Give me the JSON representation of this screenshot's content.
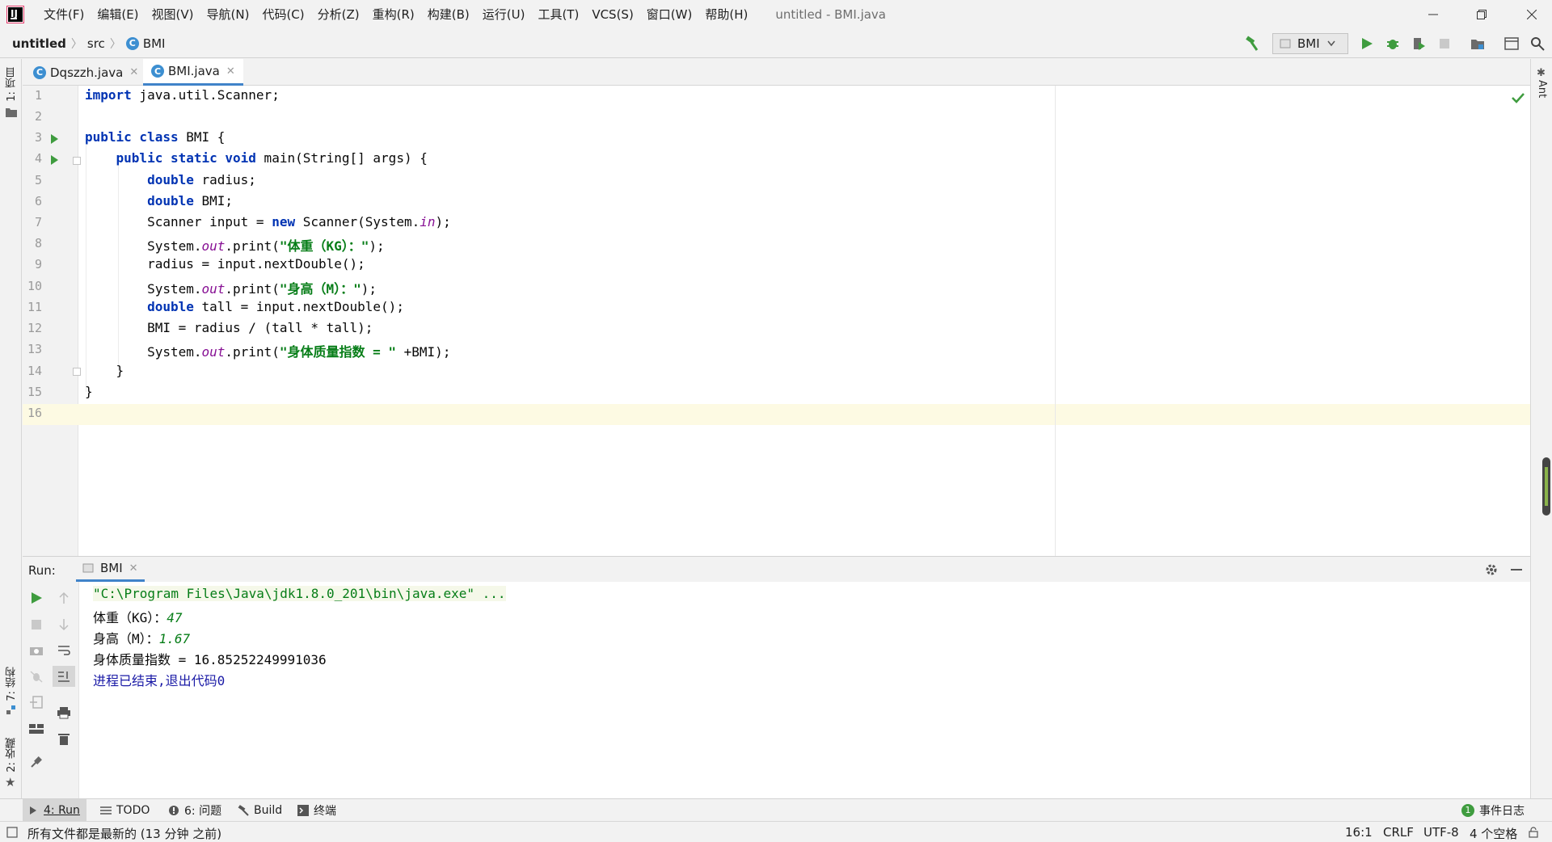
{
  "menu": {
    "items": [
      "文件(F)",
      "编辑(E)",
      "视图(V)",
      "导航(N)",
      "代码(C)",
      "分析(Z)",
      "重构(R)",
      "构建(B)",
      "运行(U)",
      "工具(T)",
      "VCS(S)",
      "窗口(W)",
      "帮助(H)"
    ],
    "window_title": "untitled - BMI.java"
  },
  "breadcrumb": {
    "project": "untitled",
    "folder": "src",
    "file": "BMI"
  },
  "toolbar": {
    "run_config": "BMI"
  },
  "side_tabs": {
    "project": "1: 项目",
    "structure": "7: 结构",
    "favorites": "2: 收藏",
    "ant": "Ant"
  },
  "editor_tabs": [
    {
      "label": "Dqszzh.java",
      "active": false
    },
    {
      "label": "BMI.java",
      "active": true
    }
  ],
  "editor": {
    "line_numbers": [
      "1",
      "2",
      "3",
      "4",
      "5",
      "6",
      "7",
      "8",
      "9",
      "10",
      "11",
      "12",
      "13",
      "14",
      "15",
      "16"
    ],
    "code": {
      "l1_kw": "import",
      "l1_rest": " java.util.Scanner;",
      "l3_kw": "public class",
      "l3_rest": " BMI {",
      "l4_indent": "    ",
      "l4_kw": "public static void",
      "l4_rest": " main(String[] args) {",
      "l5_indent": "        ",
      "l5_kw": "double",
      "l5_rest": " radius;",
      "l6_indent": "        ",
      "l6_kw": "double",
      "l6_rest": " BMI;",
      "l7_pre": "        Scanner input = ",
      "l7_kw": "new",
      "l7_mid": " Scanner(System.",
      "l7_fld": "in",
      "l7_post": ");",
      "l8_pre": "        System.",
      "l8_fld": "out",
      "l8_mid": ".print(",
      "l8_str": "\"体重（KG）：\"",
      "l8_post": ");",
      "l9": "        radius = input.nextDouble();",
      "l10_pre": "        System.",
      "l10_fld": "out",
      "l10_mid": ".print(",
      "l10_str": "\"身高（M）：\"",
      "l10_post": ");",
      "l11_indent": "        ",
      "l11_kw": "double",
      "l11_rest": " tall = input.nextDouble();",
      "l12": "        BMI = radius / (tall * tall);",
      "l13_pre": "        System.",
      "l13_fld": "out",
      "l13_mid": ".print(",
      "l13_str": "\"身体质量指数 = \"",
      "l13_post": " +BMI);",
      "l14": "    }",
      "l15": "}"
    }
  },
  "run_panel": {
    "label": "Run:",
    "tab": "BMI",
    "console": {
      "cmd": "\"C:\\Program Files\\Java\\jdk1.8.0_201\\bin\\java.exe\" ...",
      "weight_prompt": "体重（KG）：",
      "weight_input": "47",
      "height_prompt": "身高（M）：",
      "height_input": "1.67",
      "result": "身体质量指数 = 16.85252249991036",
      "exit": "进程已结束,退出代码0"
    }
  },
  "tool_tabs": {
    "run": "4: Run",
    "todo": "TODO",
    "problems": "6: 问题",
    "build": "Build",
    "terminal": "终端",
    "event_log": "事件日志",
    "event_count": "1"
  },
  "status_bar": {
    "message": "所有文件都是最新的 (13 分钟 之前)",
    "position": "16:1",
    "line_sep": "CRLF",
    "encoding": "UTF-8",
    "indent": "4 个空格"
  },
  "colors": {
    "keyword": "#0033b3",
    "string": "#067d17",
    "static_field": "#871094",
    "run_green": "#3f9c3f",
    "accent": "#4083c9",
    "exit_text": "#1a1aa6"
  }
}
